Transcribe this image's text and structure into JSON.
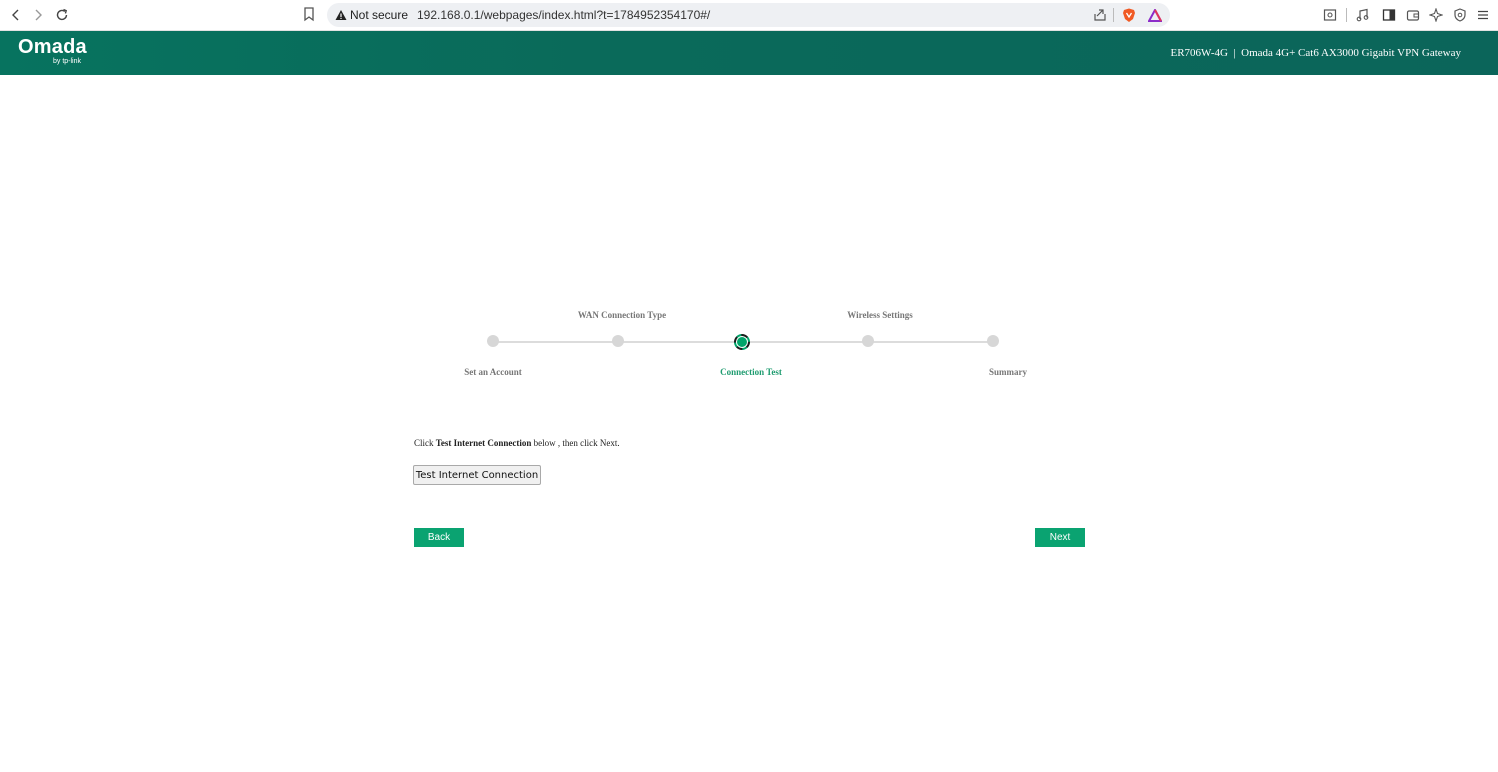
{
  "browser": {
    "security_label": "Not secure",
    "url": "192.168.0.1/webpages/index.html?t=1784952354170#/"
  },
  "header": {
    "logo": "Omada",
    "logo_sub": "by tp-link",
    "device_info": "ER706W-4G  |  Omada 4G+ Cat6 AX3000 Gigabit VPN Gateway"
  },
  "wizard": {
    "steps": [
      {
        "label": "Set an Account",
        "state": "done"
      },
      {
        "label": "WAN Connection Type",
        "state": "done"
      },
      {
        "label": "Connection Test",
        "state": "active"
      },
      {
        "label": "Wireless Settings",
        "state": "pending"
      },
      {
        "label": "Summary",
        "state": "pending"
      }
    ],
    "instruction_prefix": "Click ",
    "instruction_bold": "Test Internet Connection",
    "instruction_suffix": " below , then click Next.",
    "test_button": "Test Internet Connection",
    "back_button": "Back",
    "next_button": "Next"
  },
  "colors": {
    "header_bg": "#07735f",
    "accent": "#0aa371",
    "active_step_label": "#1f9c70"
  }
}
